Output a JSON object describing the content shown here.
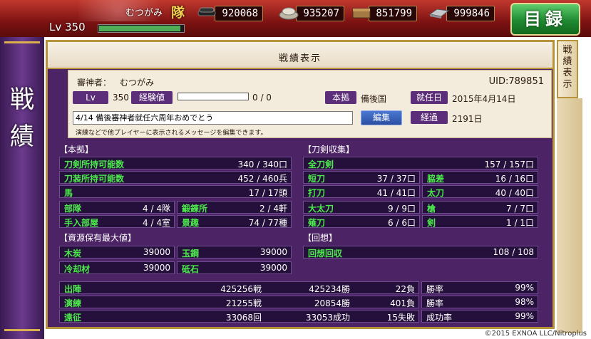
{
  "header": {
    "team_name": "むつがみ",
    "team_suffix": "隊",
    "level_label": "Lv 350",
    "exp_fraction": 0.95,
    "resources": [
      {
        "name": "charcoal-icon",
        "value": "920068"
      },
      {
        "name": "steel-icon",
        "value": "935207"
      },
      {
        "name": "coolant-icon",
        "value": "851799"
      },
      {
        "name": "whetstone-icon",
        "value": "999846"
      }
    ],
    "catalog_button": "目録"
  },
  "left_title": [
    "戦",
    "績"
  ],
  "right_tab": [
    "戦",
    "績",
    "表",
    "示"
  ],
  "panel_title": "戦績表示",
  "profile": {
    "name_label": "審神者：",
    "name_value": "むつがみ",
    "uid": "UID:789851",
    "lv_label": "Lv",
    "lv_value": "350",
    "exp_label": "経験値",
    "exp_fraction": 0,
    "exp_text": "0 / 0",
    "base_label": "本拠",
    "base_value": "備後国",
    "appointed_label": "就任日",
    "appointed_value": "2015年4月14日",
    "message": "4/14 備後審神者就任六周年おめでとう",
    "edit_button": "編集",
    "elapsed_label": "経過",
    "elapsed_value": "2191日",
    "note": "演練などで他プレイヤーに表示されるメッセージを編集できます。"
  },
  "base_section": {
    "title": "【本拠】",
    "rows": [
      {
        "label": "刀剣所持可能数",
        "value": "340 / 340口"
      },
      {
        "label": "刀装所持可能数",
        "value": "452 / 460兵"
      },
      {
        "label": "馬",
        "value": "17 / 17頭"
      }
    ],
    "pairs": [
      [
        {
          "label": "部隊",
          "value": "4 / 4隊"
        },
        {
          "label": "鍛錬所",
          "value": "2 / 4軒"
        }
      ],
      [
        {
          "label": "手入部屋",
          "value": "4 / 4室"
        },
        {
          "label": "景趣",
          "value": "74 / 77種"
        }
      ]
    ]
  },
  "swords_section": {
    "title": "【刀剣収集】",
    "total": {
      "label": "全刀剣",
      "value": "157 / 157口"
    },
    "pairs": [
      [
        {
          "label": "短刀",
          "value": "37 / 37口"
        },
        {
          "label": "脇差",
          "value": "16 / 16口"
        }
      ],
      [
        {
          "label": "打刀",
          "value": "41 / 41口"
        },
        {
          "label": "太刀",
          "value": "40 / 40口"
        }
      ],
      [
        {
          "label": "大太刀",
          "value": "9 / 9口"
        },
        {
          "label": "槍",
          "value": "7 / 7口"
        }
      ],
      [
        {
          "label": "薙刀",
          "value": "6 / 6口"
        },
        {
          "label": "剣",
          "value": "1 / 1口"
        }
      ]
    ]
  },
  "resources_section": {
    "title": "【資源保有最大値】",
    "pairs": [
      [
        {
          "label": "木炭",
          "value": "39000"
        },
        {
          "label": "玉鋼",
          "value": "39000"
        }
      ],
      [
        {
          "label": "冷却材",
          "value": "39000"
        },
        {
          "label": "砥石",
          "value": "39000"
        }
      ]
    ]
  },
  "memory_section": {
    "title": "【回想】",
    "row": {
      "label": "回想回収",
      "value": "108 / 108"
    }
  },
  "battle": [
    {
      "label": "出陣",
      "count": "425256戦",
      "win": "425234勝",
      "loss": "22負",
      "rate_label": "勝率",
      "rate": "99%"
    },
    {
      "label": "演練",
      "count": "21255戦",
      "win": "20854勝",
      "loss": "401負",
      "rate_label": "勝率",
      "rate": "98%"
    },
    {
      "label": "遠征",
      "count": "33068回",
      "win": "33053成功",
      "loss": "15失敗",
      "rate_label": "成功率",
      "rate": "99%"
    }
  ],
  "copyright": "©2015 EXNOA LLC/Nitroplus"
}
